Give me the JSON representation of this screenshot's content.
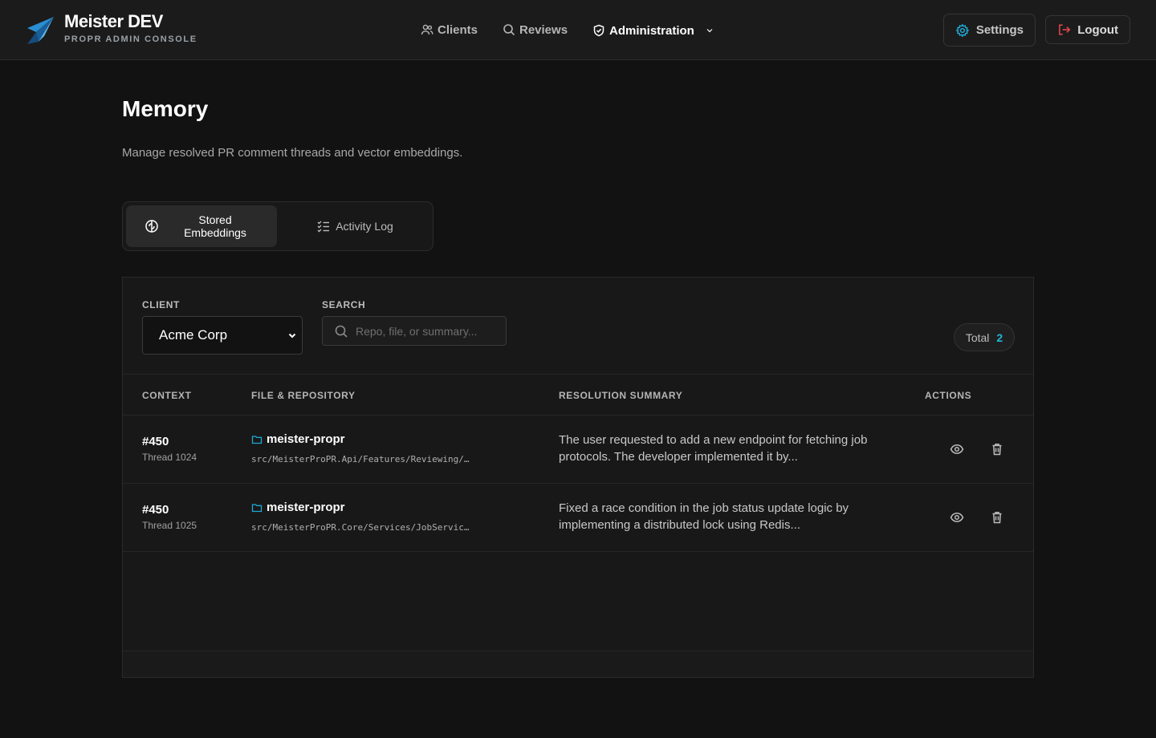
{
  "header": {
    "brand_title": "Meister DEV",
    "brand_subtitle": "PROPR ADMIN CONSOLE",
    "nav": {
      "clients": "Clients",
      "reviews": "Reviews",
      "administration": "Administration"
    },
    "settings_label": "Settings",
    "logout_label": "Logout",
    "accent_color": "#1fa8d6",
    "logout_color": "#e5484d"
  },
  "page": {
    "title": "Memory",
    "description": "Manage resolved PR comment threads and vector embeddings."
  },
  "tabs": {
    "stored_embeddings": "Stored Embeddings",
    "activity_log": "Activity Log",
    "active": "Stored Embeddings"
  },
  "filters": {
    "client_label": "CLIENT",
    "client_value": "Acme Corp",
    "search_label": "SEARCH",
    "search_placeholder": "Repo, file, or summary...",
    "search_value": "",
    "total_label": "Total",
    "total_value": "2"
  },
  "table": {
    "columns": {
      "context": "CONTEXT",
      "file_repo": "FILE & REPOSITORY",
      "summary": "RESOLUTION SUMMARY",
      "actions": "ACTIONS"
    },
    "rows": [
      {
        "pr": "#450",
        "thread": "Thread 1024",
        "repo": "meister-propr",
        "path": "src/MeisterProPR.Api/Features/Reviewing/…",
        "summary": "The user requested to add a new endpoint for fetching job protocols. The developer implemented it by..."
      },
      {
        "pr": "#450",
        "thread": "Thread 1025",
        "repo": "meister-propr",
        "path": "src/MeisterProPR.Core/Services/JobServic…",
        "summary": "Fixed a race condition in the job status update logic by implementing a distributed lock using Redis..."
      }
    ]
  }
}
